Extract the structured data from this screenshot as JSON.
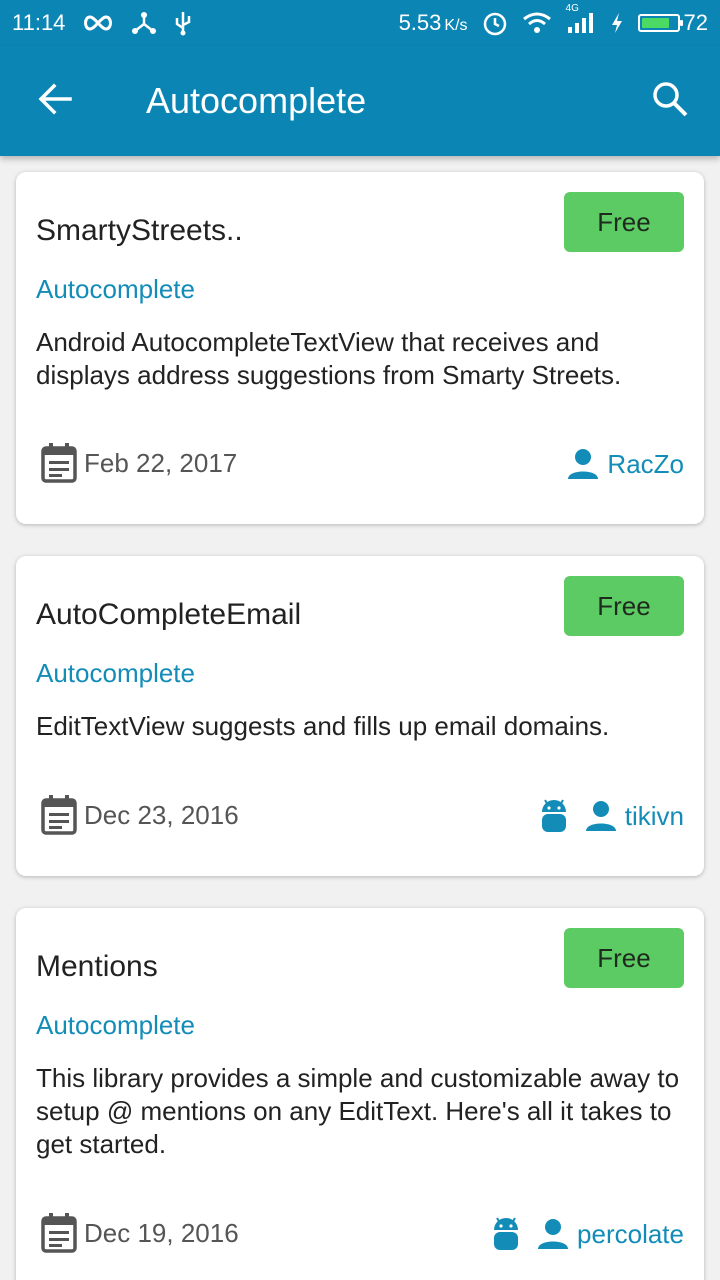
{
  "status_bar": {
    "time": "11:14",
    "speed": "5.53",
    "speed_unit": "K/s",
    "network": "4G",
    "battery_level": "72"
  },
  "app_bar": {
    "title": "Autocomplete"
  },
  "cards": [
    {
      "name": "SmartyStreets..",
      "badge": "Free",
      "category": "Autocomplete",
      "description": "Android AutocompleteTextView that receives and displays address suggestions from Smarty Streets.",
      "date": "Feb 22, 2017",
      "author": "RacZo",
      "android_icon": false
    },
    {
      "name": "AutoCompleteEmail",
      "badge": "Free",
      "category": "Autocomplete",
      "description": "EditTextView suggests and fills up email domains.",
      "date": "Dec 23, 2016",
      "author": "tikivn",
      "android_icon": true
    },
    {
      "name": "Mentions",
      "badge": "Free",
      "category": "Autocomplete",
      "description": "This library provides a simple and customizable away to setup @ mentions on any EditText. Here's all it takes to get started.",
      "date": "Dec 19, 2016",
      "author": "percolate",
      "android_icon": true
    }
  ],
  "colors": {
    "primary": "#0b86b4",
    "accent_text": "#138db8",
    "badge_green": "#5ccb64"
  }
}
